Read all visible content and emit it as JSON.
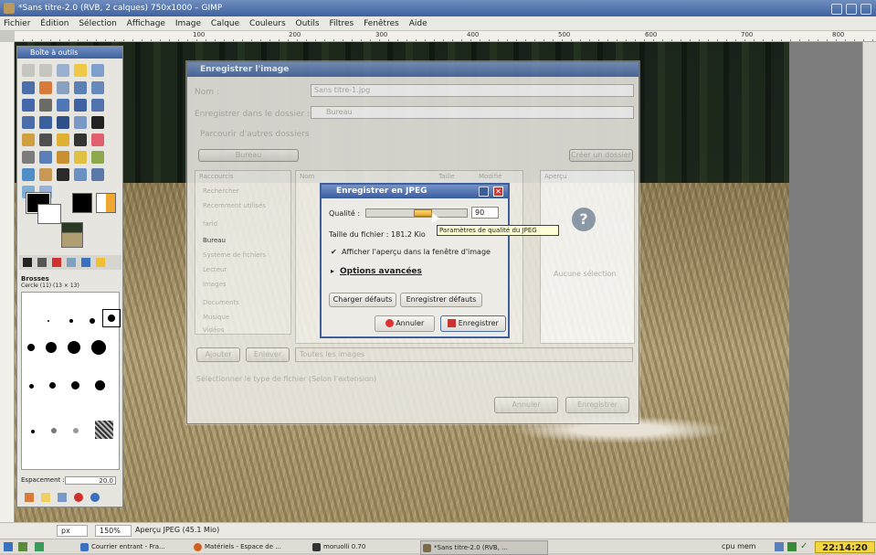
{
  "window": {
    "title": "*Sans titre-2.0 (RVB, 2 calques) 750x1000 – GIMP"
  },
  "menu": [
    "Fichier",
    "Édition",
    "Sélection",
    "Affichage",
    "Image",
    "Calque",
    "Couleurs",
    "Outils",
    "Filtres",
    "Fenêtres",
    "Aide"
  ],
  "ruler": [
    "100",
    "200",
    "300",
    "400",
    "500",
    "600",
    "700",
    "800"
  ],
  "toolbox": {
    "title": "Boîte à outils",
    "brushes_title": "Brosses",
    "brush_name": "Cercle (11) (13 × 13)",
    "spacing_label": "Espacement :",
    "spacing_value": "20.0"
  },
  "save_dialog": {
    "title": "Enregistrer l'image",
    "name_label": "Nom :",
    "name_value": "Sans titre-1.jpg",
    "folder_label": "Enregistrer dans le dossier :",
    "folder_value": "Bureau",
    "browse_label": "Parcourir d'autres dossiers",
    "path_segments": [
      "Bureau"
    ],
    "create_folder": "Créer un dossier",
    "col_places": "Raccourcis",
    "col_name": "Nom",
    "col_size": "Taille",
    "col_modified": "Modifié",
    "col_preview": "Aperçu",
    "places": [
      "Rechercher",
      "Récemment utilisés",
      "farid",
      "Bureau",
      "Système de fichiers",
      "Lecteur",
      "Images",
      "Documents",
      "Musique",
      "Vidéos"
    ],
    "add_btn": "Ajouter",
    "remove_btn": "Enlever",
    "filter_value": "Toutes les images",
    "no_selection": "Aucune sélection",
    "filetype_label": "Sélectionner le type de fichier (Selon l'extension)",
    "cancel": "Annuler",
    "save": "Enregistrer"
  },
  "jpeg_dialog": {
    "title": "Enregistrer en JPEG",
    "quality_label": "Qualité :",
    "quality_value": "90",
    "quality_fraction": 0.9,
    "filesize": "Taille du fichier : 181.2 Kio",
    "preview_checkbox": "Afficher l'aperçu dans la fenêtre d'image",
    "advanced": "Options avancées",
    "load_defaults": "Charger défauts",
    "save_defaults": "Enregistrer défauts",
    "cancel": "Annuler",
    "save": "Enregistrer",
    "tooltip": "Paramètres de qualité du JPEG"
  },
  "status": {
    "unit": "px",
    "zoom": "150%",
    "info": "Aperçu JPEG (45.1 Mio)"
  },
  "taskbar": {
    "tasks": [
      "Courrier entrant - Fra...",
      "Matériels - Espace de ...",
      "moruolli 0.70",
      "*Sans titre-2.0 (RVB, ..."
    ],
    "tray_text": "cpu  mem",
    "clock": "22:14:20"
  }
}
